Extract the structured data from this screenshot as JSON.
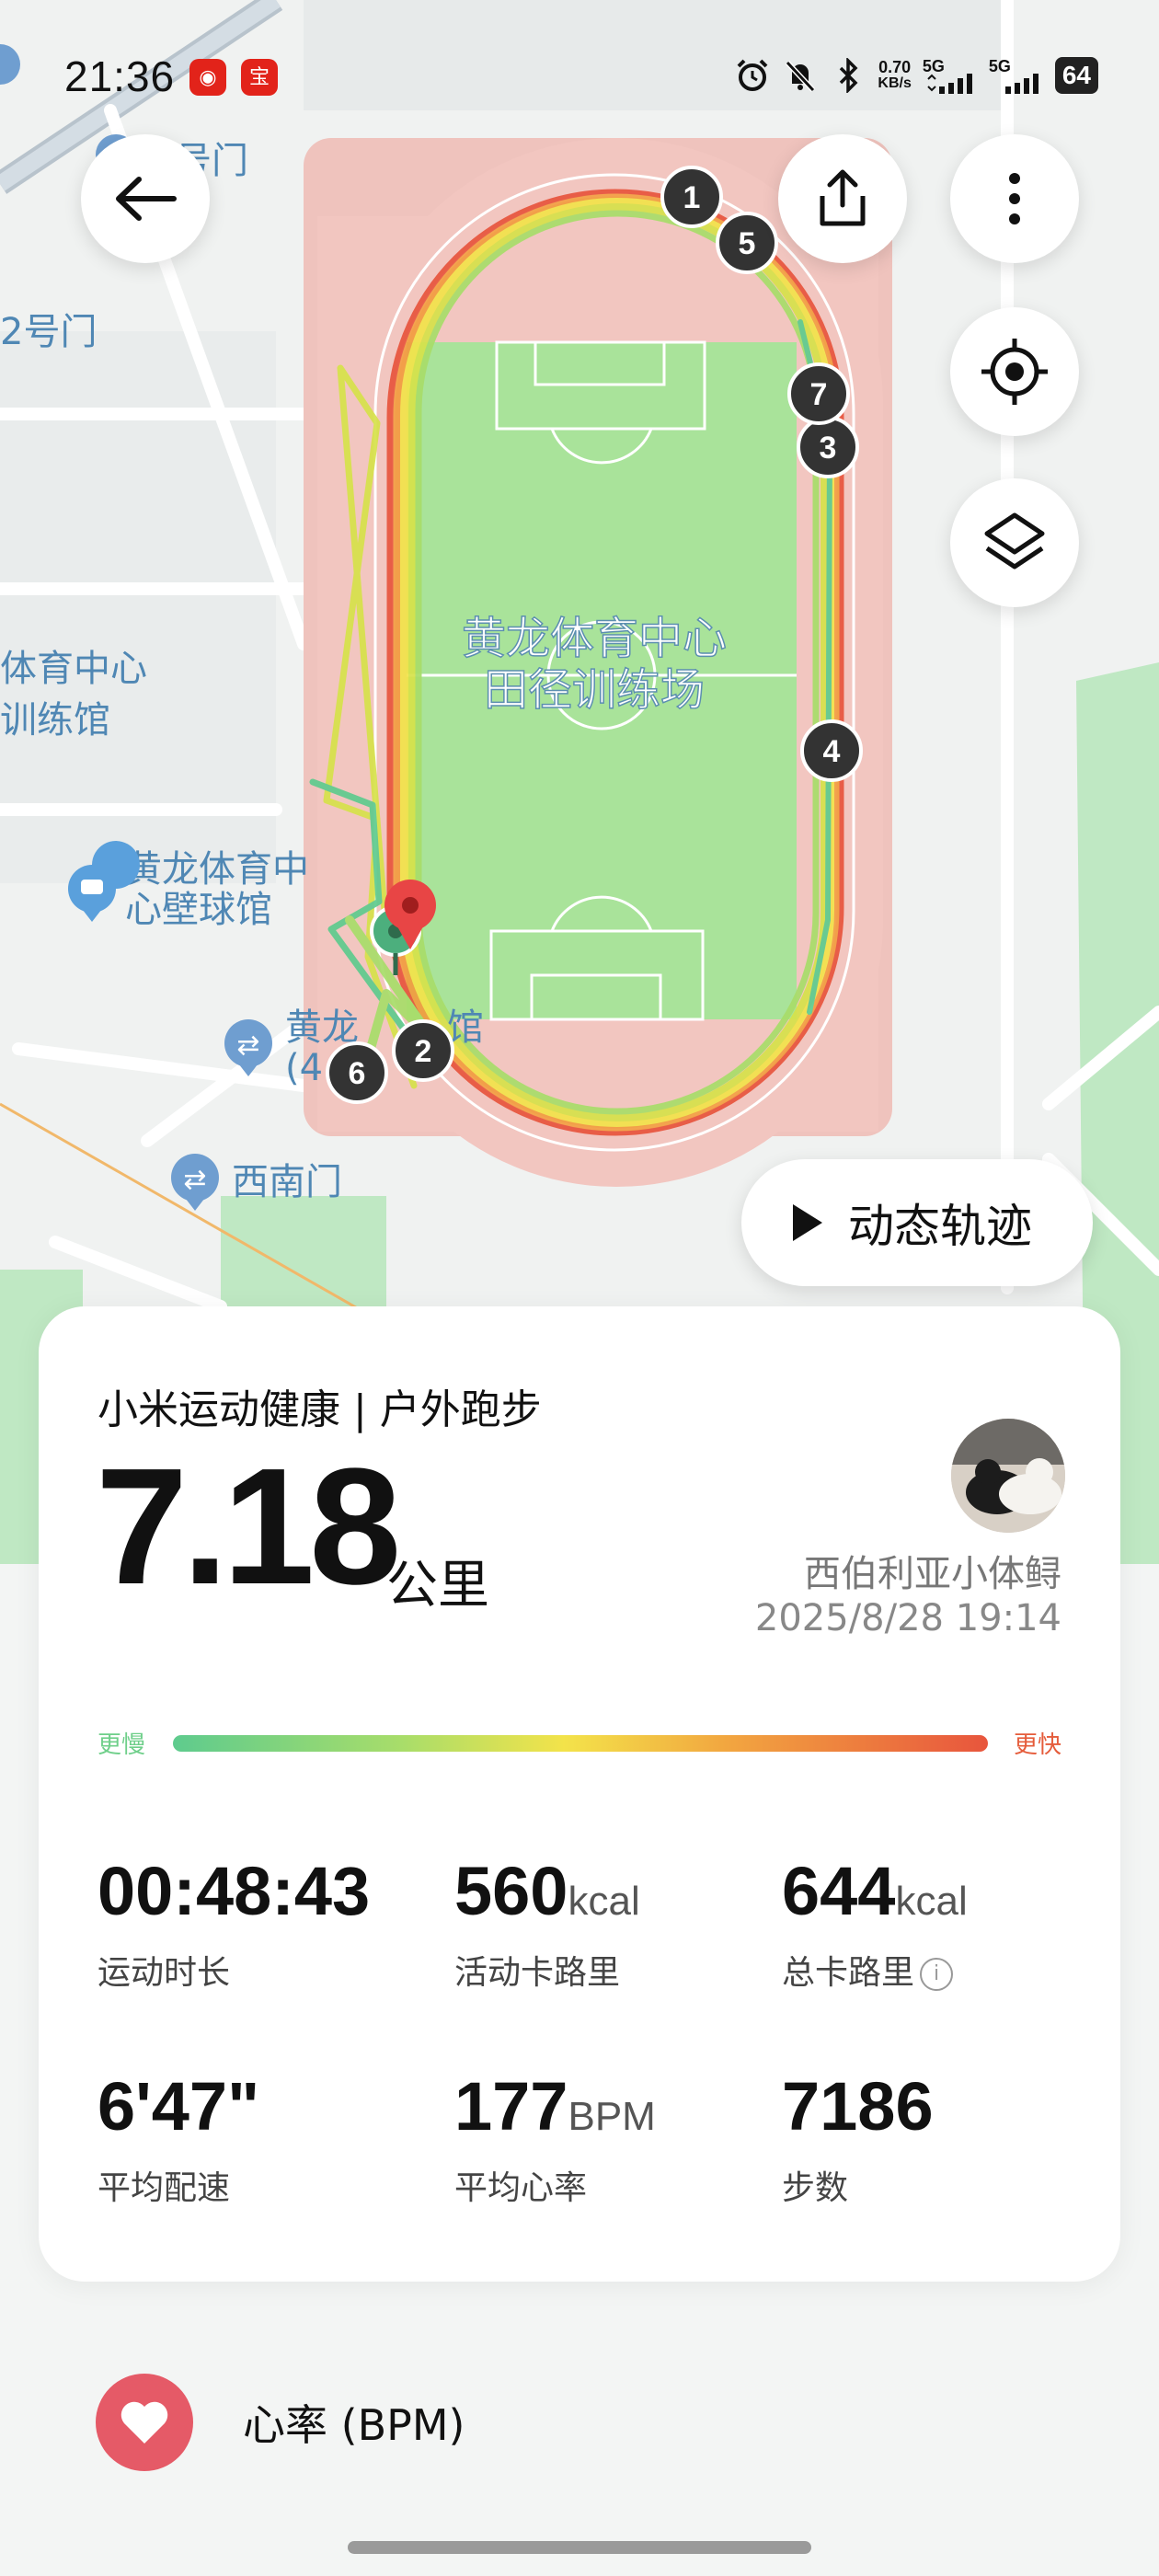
{
  "status_bar": {
    "time": "21:36",
    "net_speed_value": "0.70",
    "net_speed_unit": "KB/s",
    "sim1": "5G",
    "sim2": "5G",
    "battery": "64"
  },
  "map": {
    "venue_name_line1": "黄龙体育中心",
    "venue_name_line2": "田径训练场",
    "pois": [
      {
        "label": "号门"
      },
      {
        "label": "2号门"
      },
      {
        "label": "体育中心"
      },
      {
        "label": "训练馆"
      },
      {
        "label_line1": "黄龙体育中",
        "label_line2": "心壁球馆"
      },
      {
        "label_line1": "黄龙",
        "label_suffix": "馆",
        "label_line2": "(4"
      },
      {
        "label": "西南门"
      }
    ],
    "km_markers": [
      "1",
      "2",
      "3",
      "4",
      "5",
      "6",
      "7"
    ],
    "colors": {
      "track": "#f2c6c0",
      "field": "#a9e39a",
      "route_fast": "#e8553d",
      "route_mid": "#f3e34a",
      "route_slow": "#5ecb8e"
    }
  },
  "buttons": {
    "back": "back-arrow",
    "share": "share",
    "more": "more",
    "locate": "locate",
    "layers": "layers",
    "dynamic_track": "动态轨迹"
  },
  "summary": {
    "brand": "小米运动健康 | 户外跑步",
    "distance": "7.18",
    "distance_unit": "公里",
    "username": "西伯利亚小体鲟",
    "datetime": "2025/8/28 19:14",
    "pace_slow": "更慢",
    "pace_fast": "更快"
  },
  "metrics": [
    {
      "value": "00:48:43",
      "unit": "",
      "label": "运动时长"
    },
    {
      "value": "560",
      "unit": "kcal",
      "label": "活动卡路里"
    },
    {
      "value": "644",
      "unit": "kcal",
      "label": "总卡路里"
    },
    {
      "value": "6'47\"",
      "unit": "",
      "label": "平均配速"
    },
    {
      "value": "177",
      "unit": "BPM",
      "label": "平均心率"
    },
    {
      "value": "7186",
      "unit": "",
      "label": "步数"
    }
  ],
  "heart_rate": {
    "label": "心率 (BPM)"
  }
}
